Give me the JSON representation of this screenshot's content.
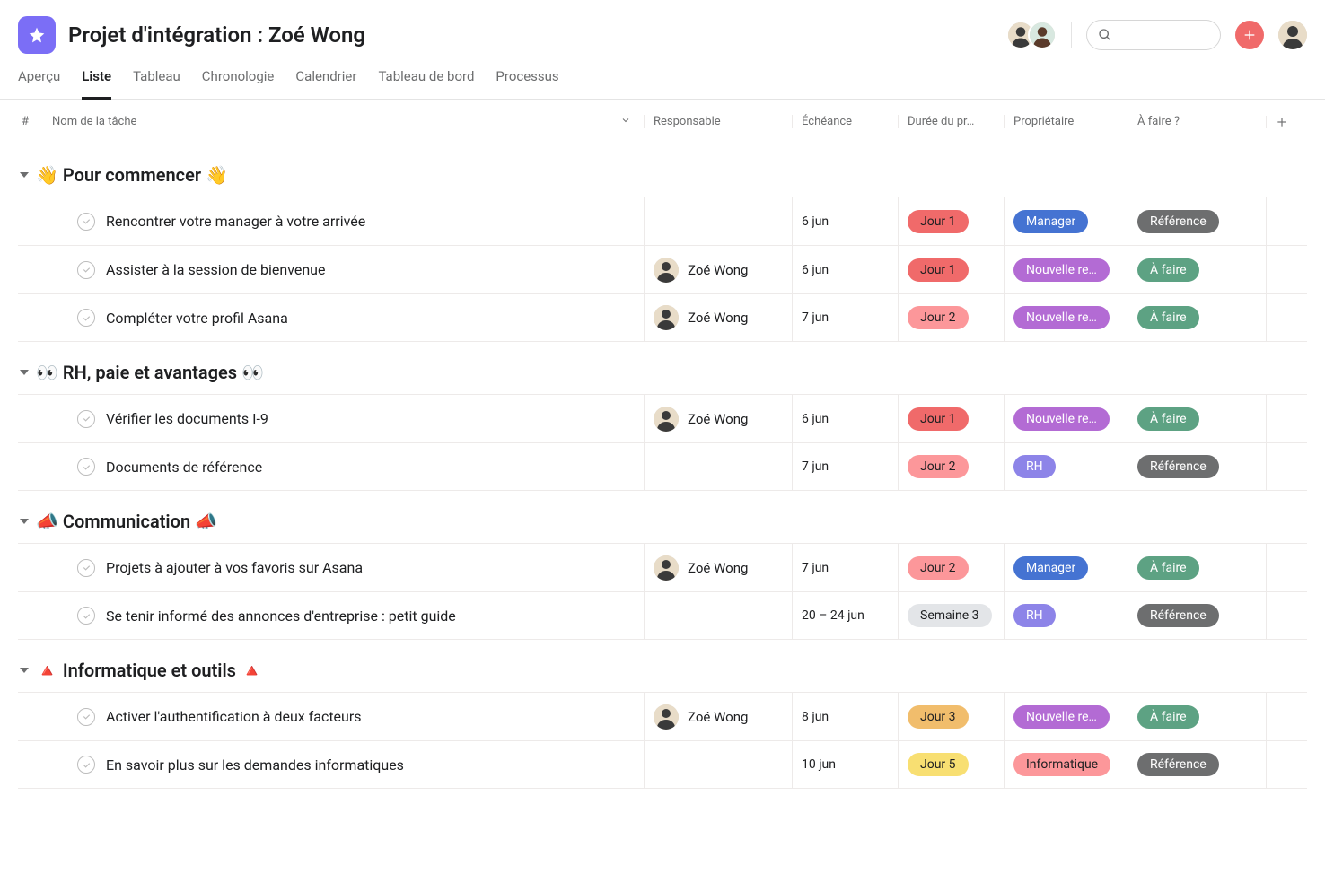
{
  "project": {
    "title": "Projet d'intégration : Zoé Wong"
  },
  "tabs": [
    {
      "label": "Aperçu",
      "active": false
    },
    {
      "label": "Liste",
      "active": true
    },
    {
      "label": "Tableau",
      "active": false
    },
    {
      "label": "Chronologie",
      "active": false
    },
    {
      "label": "Calendrier",
      "active": false
    },
    {
      "label": "Tableau de bord",
      "active": false
    },
    {
      "label": "Processus",
      "active": false
    }
  ],
  "columns": {
    "num": "#",
    "name": "Nom de la tâche",
    "resp": "Responsable",
    "due": "Échéance",
    "duration": "Durée du pr…",
    "owner": "Propriétaire",
    "todo": "À faire ?"
  },
  "pill_colors": {
    "jour1": "#f06a6a",
    "jour2": "#fc979a",
    "jour3": "#f1bd6c",
    "jour5": "#f8df72",
    "semaine3": "#e3e5e8",
    "manager": "#4573d2",
    "nouvelle": "#b36bd4",
    "rh": "#8d84e8",
    "informatique": "#fc979a",
    "a_faire": "#5da283",
    "reference": "#6d6e6f"
  },
  "sections": [
    {
      "title": "👋 Pour commencer 👋",
      "rows": [
        {
          "name": "Rencontrer votre manager à votre arrivée",
          "resp": null,
          "due": "6 jun",
          "duration": {
            "label": "Jour 1",
            "color": "jour1"
          },
          "owner": {
            "label": "Manager",
            "color": "manager",
            "white": true
          },
          "todo": {
            "label": "Référence",
            "color": "reference",
            "white": true
          }
        },
        {
          "name": "Assister à la session de bienvenue",
          "resp": "Zoé Wong",
          "due": "6 jun",
          "duration": {
            "label": "Jour 1",
            "color": "jour1"
          },
          "owner": {
            "label": "Nouvelle re…",
            "color": "nouvelle",
            "white": true
          },
          "todo": {
            "label": "À faire",
            "color": "a_faire",
            "white": true
          }
        },
        {
          "name": "Compléter votre profil Asana",
          "resp": "Zoé Wong",
          "due": "7 jun",
          "duration": {
            "label": "Jour 2",
            "color": "jour2"
          },
          "owner": {
            "label": "Nouvelle re…",
            "color": "nouvelle",
            "white": true
          },
          "todo": {
            "label": "À faire",
            "color": "a_faire",
            "white": true
          }
        }
      ]
    },
    {
      "title": "👀 RH, paie et avantages 👀",
      "rows": [
        {
          "name": "Vérifier les documents I-9",
          "resp": "Zoé Wong",
          "due": "6 jun",
          "duration": {
            "label": "Jour 1",
            "color": "jour1"
          },
          "owner": {
            "label": "Nouvelle re…",
            "color": "nouvelle",
            "white": true
          },
          "todo": {
            "label": "À faire",
            "color": "a_faire",
            "white": true
          }
        },
        {
          "name": "Documents de référence",
          "resp": null,
          "due": "7 jun",
          "duration": {
            "label": "Jour 2",
            "color": "jour2"
          },
          "owner": {
            "label": "RH",
            "color": "rh",
            "white": true
          },
          "todo": {
            "label": "Référence",
            "color": "reference",
            "white": true
          }
        }
      ]
    },
    {
      "title": "📣 Communication 📣",
      "rows": [
        {
          "name": "Projets à ajouter à vos favoris sur Asana",
          "resp": "Zoé Wong",
          "due": "7 jun",
          "duration": {
            "label": "Jour 2",
            "color": "jour2"
          },
          "owner": {
            "label": "Manager",
            "color": "manager",
            "white": true
          },
          "todo": {
            "label": "À faire",
            "color": "a_faire",
            "white": true
          }
        },
        {
          "name": "Se tenir informé des annonces d'entreprise : petit guide",
          "resp": null,
          "due": "20 – 24 jun",
          "duration": {
            "label": "Semaine 3",
            "color": "semaine3"
          },
          "owner": {
            "label": "RH",
            "color": "rh",
            "white": true
          },
          "todo": {
            "label": "Référence",
            "color": "reference",
            "white": true
          }
        }
      ]
    },
    {
      "title": "🔺 Informatique et outils 🔺",
      "rows": [
        {
          "name": "Activer l'authentification à deux facteurs",
          "resp": "Zoé Wong",
          "due": "8 jun",
          "duration": {
            "label": "Jour 3",
            "color": "jour3"
          },
          "owner": {
            "label": "Nouvelle re…",
            "color": "nouvelle",
            "white": true
          },
          "todo": {
            "label": "À faire",
            "color": "a_faire",
            "white": true
          }
        },
        {
          "name": "En savoir plus sur les demandes informatiques",
          "resp": null,
          "due": "10 jun",
          "duration": {
            "label": "Jour 5",
            "color": "jour5"
          },
          "owner": {
            "label": "Informatique",
            "color": "informatique"
          },
          "todo": {
            "label": "Référence",
            "color": "reference",
            "white": true
          }
        }
      ]
    }
  ]
}
